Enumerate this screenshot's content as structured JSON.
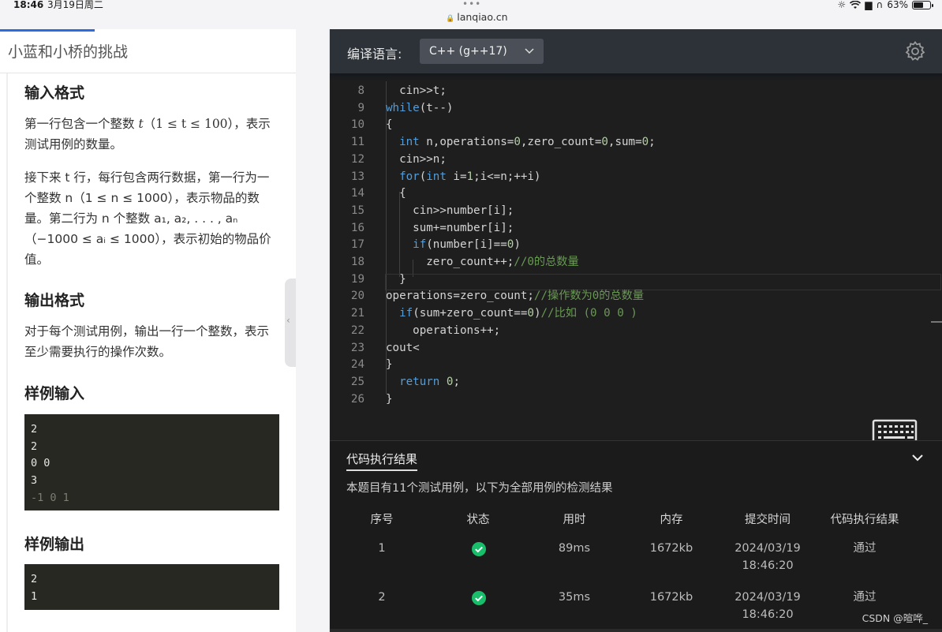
{
  "status_bar": {
    "time": "18:46",
    "date": "3月19日周二",
    "url": "lanqiao.cn",
    "battery": "63%",
    "battery_level": 0.63
  },
  "problem": {
    "title": "小蓝和小桥的挑战",
    "input_heading": "输入格式",
    "input_p1_a": "第一行包含一个整数 ",
    "input_p1_var": "t",
    "input_p1_b": "（",
    "input_p1_math": "1 ≤ t ≤ 100",
    "input_p1_c": "），表示测试用例的数量。",
    "input_p2": "接下来 t 行，每行包含两行数据，第一行为一个整数 n（1 ≤ n ≤ 1000），表示物品的数量。第二行为 n 个整数 a₁, a₂, . . . , aₙ（−1000 ≤ aᵢ ≤ 1000），表示初始的物品价值。",
    "output_heading": "输出格式",
    "output_p": "对于每个测试用例，输出一行一个整数，表示至少需要执行的操作次数。",
    "sample_input_heading": "样例输入",
    "sample_input_lines": [
      "2",
      "2",
      "0 0",
      "3",
      "-1 0 1"
    ],
    "sample_output_heading": "样例输出",
    "sample_output_lines": [
      "2",
      "1"
    ]
  },
  "editor": {
    "language_label": "编译语言:",
    "language_value": "C++ (g++17)",
    "settings_icon": "gear-icon",
    "keyboard_icon": "keyboard-icon",
    "line_numbers": [
      "8",
      "9",
      "10",
      "11",
      "12",
      "13",
      "14",
      "15",
      "16",
      "17",
      "18",
      "19",
      "20",
      "21",
      "22",
      "23",
      "24",
      "25",
      "26"
    ]
  },
  "results": {
    "tab_label": "代码执行结果",
    "summary": "本题目有11个测试用例，以下为全部用例的检测结果",
    "headers": [
      "序号",
      "状态",
      "用时",
      "内存",
      "提交时间",
      "代码执行结果"
    ],
    "rows": [
      {
        "index": "1",
        "status": "passed",
        "time": "89ms",
        "memory": "1672kb",
        "date": "2024/03/19",
        "clock": "18:46:20",
        "result": "通过"
      },
      {
        "index": "2",
        "status": "passed",
        "time": "35ms",
        "memory": "1672kb",
        "date": "2024/03/19",
        "clock": "18:46:20",
        "result": "通过"
      }
    ]
  },
  "watermark": "CSDN @暄哗_",
  "colors": {
    "accent_blue": "#2b6ce0",
    "success_green": "#19be6b",
    "editor_bg": "#1e1e1e",
    "keyword": "#569cd6",
    "comment": "#6a9955"
  }
}
